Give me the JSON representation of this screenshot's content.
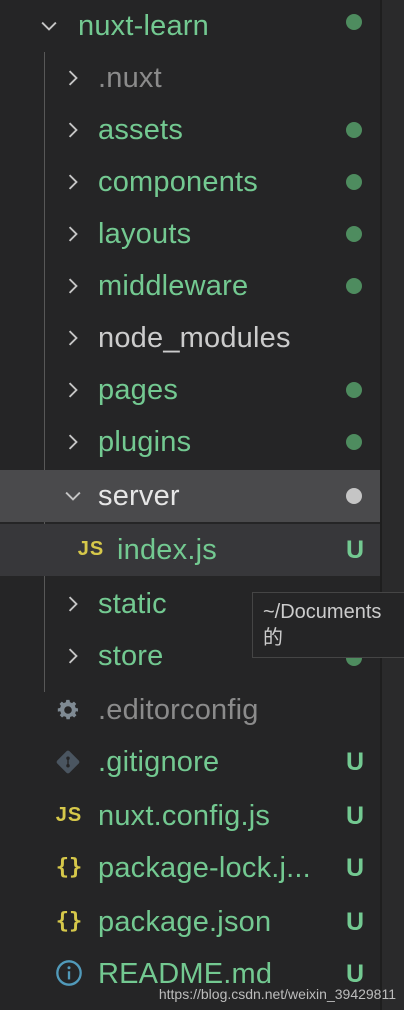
{
  "explorer": {
    "root": {
      "label": "nuxt-learn",
      "expanded": true,
      "status": "modified-dot"
    },
    "items": [
      {
        "label": ".nuxt",
        "kind": "folder",
        "expanded": false,
        "color": "dim",
        "status": ""
      },
      {
        "label": "assets",
        "kind": "folder",
        "expanded": false,
        "color": "green",
        "status": "dot"
      },
      {
        "label": "components",
        "kind": "folder",
        "expanded": false,
        "color": "green",
        "status": "dot"
      },
      {
        "label": "layouts",
        "kind": "folder",
        "expanded": false,
        "color": "green",
        "status": "dot"
      },
      {
        "label": "middleware",
        "kind": "folder",
        "expanded": false,
        "color": "green",
        "status": "dot"
      },
      {
        "label": "node_modules",
        "kind": "folder",
        "expanded": false,
        "color": "white",
        "status": ""
      },
      {
        "label": "pages",
        "kind": "folder",
        "expanded": false,
        "color": "green",
        "status": "dot"
      },
      {
        "label": "plugins",
        "kind": "folder",
        "expanded": false,
        "color": "green",
        "status": "dot"
      },
      {
        "label": "server",
        "kind": "folder",
        "expanded": true,
        "color": "white",
        "status": "dot-grey"
      },
      {
        "label": "index.js",
        "kind": "file-js",
        "color": "green",
        "status": "U"
      },
      {
        "label": "static",
        "kind": "folder",
        "expanded": false,
        "color": "green",
        "status": "dot"
      },
      {
        "label": "store",
        "kind": "folder",
        "expanded": false,
        "color": "green",
        "status": "dot"
      },
      {
        "label": ".editorconfig",
        "kind": "file-gear",
        "color": "dim",
        "status": ""
      },
      {
        "label": ".gitignore",
        "kind": "file-git",
        "color": "green",
        "status": "U"
      },
      {
        "label": "nuxt.config.js",
        "kind": "file-js",
        "color": "green",
        "status": "U"
      },
      {
        "label": "package-lock.j...",
        "kind": "file-json",
        "color": "green",
        "status": "U"
      },
      {
        "label": "package.json",
        "kind": "file-json",
        "color": "green",
        "status": "U"
      },
      {
        "label": "README.md",
        "kind": "file-info",
        "color": "green",
        "status": "U"
      }
    ]
  },
  "tooltip": {
    "line1": "~/Documents",
    "line2": "的"
  },
  "watermark": "https://blog.csdn.net/weixin_39429811",
  "colors": {
    "background": "#252526",
    "git_green": "#73c991",
    "dot_green": "#4e8c5f",
    "js_yellow": "#d6c84a",
    "selected_row": "#4a4a4c"
  }
}
